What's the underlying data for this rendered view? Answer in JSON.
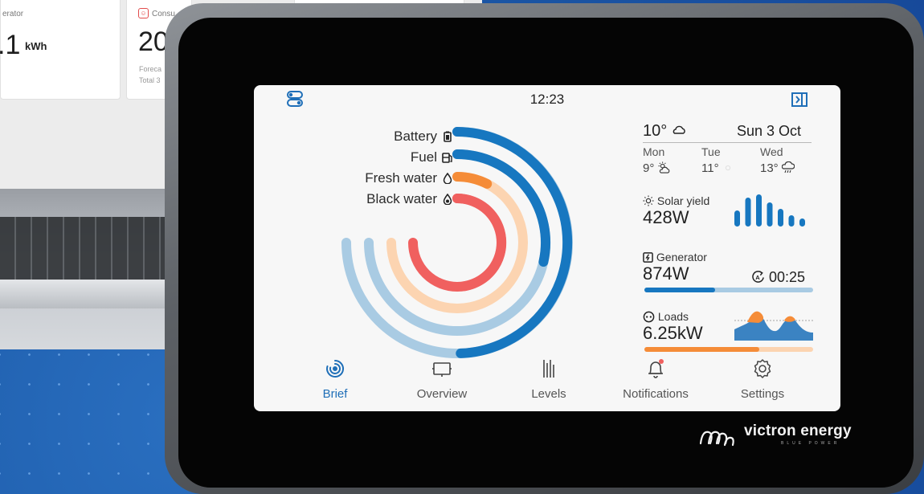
{
  "background": {
    "cards": [
      {
        "label": "erator",
        "value": ".1",
        "unit": "kWh"
      },
      {
        "label": "Consu",
        "value": "20",
        "lines": [
          "Foreca",
          "Total 3"
        ]
      }
    ]
  },
  "brand": {
    "name": "victron energy",
    "tagline": "BLUE POWER"
  },
  "status_bar": {
    "time": "12:23",
    "left_icon": "toggle-icon",
    "right_icon": "sidebar-panel-icon"
  },
  "levels": [
    {
      "label": "Battery",
      "icon": "battery-icon",
      "fraction": 0.66,
      "color": "#1777c0",
      "track": "#a9cbe3"
    },
    {
      "label": "Fuel",
      "icon": "fuel-icon",
      "fraction": 0.38,
      "color": "#1777c0",
      "track": "#a9cbe3"
    },
    {
      "label": "Fresh water",
      "icon": "water-drop-icon",
      "fraction": 0.1,
      "color": "#f58c38",
      "track": "#fcd4b1"
    },
    {
      "label": "Black water",
      "icon": "black-water-icon",
      "fraction": 0.63,
      "color": "#f0605f",
      "track": "#f0605f"
    }
  ],
  "weather": {
    "current_temp": "10°",
    "condition_icon": "cloud-icon",
    "date": "Sun 3 Oct",
    "forecast": [
      {
        "day": "Mon",
        "temp": "9°",
        "icon": "partly-sunny-icon"
      },
      {
        "day": "Tue",
        "temp": "11°",
        "icon": "sun-icon"
      },
      {
        "day": "Wed",
        "temp": "13°",
        "icon": "rain-icon"
      }
    ]
  },
  "solar": {
    "title": "Solar yield",
    "value": "428",
    "unit": "W",
    "bars": [
      0.5,
      0.9,
      1.0,
      0.75,
      0.55,
      0.35,
      0.25
    ]
  },
  "generator": {
    "title": "Generator",
    "value": "874",
    "unit": "W",
    "runtime": "00:25",
    "fraction": 0.42
  },
  "loads": {
    "title": "Loads",
    "value": "6.25",
    "unit": "kW",
    "fraction": 0.68
  },
  "colors": {
    "accent": "#1f6fb8",
    "orange": "#f58c38",
    "red": "#f0605f",
    "light_blue": "#a9cbe3"
  },
  "nav": [
    {
      "label": "Brief",
      "icon": "brief-icon",
      "active": true
    },
    {
      "label": "Overview",
      "icon": "overview-icon",
      "active": false
    },
    {
      "label": "Levels",
      "icon": "levels-icon",
      "active": false
    },
    {
      "label": "Notifications",
      "icon": "notifications-icon",
      "active": false
    },
    {
      "label": "Settings",
      "icon": "settings-icon",
      "active": false
    }
  ]
}
